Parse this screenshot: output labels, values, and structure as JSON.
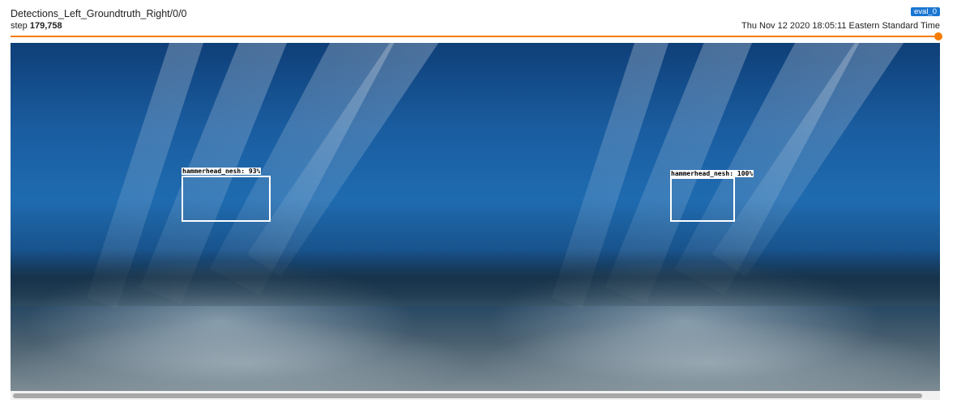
{
  "card": {
    "title": "Detections_Left_Groundtruth_Right/0/0",
    "step_label": "step",
    "step_value": "179,758",
    "run_badge": "eval_0",
    "timestamp": "Thu Nov 12 2020 18:05:11 Eastern Standard Time"
  },
  "slider": {
    "accent_color": "#f57c00",
    "position_fraction": 1.0
  },
  "image": {
    "left_panel": {
      "detection_label": "hammerhead_nesh: 93%"
    },
    "right_panel": {
      "detection_label": "hammerhead_nesh: 100%"
    }
  },
  "run_badge_color": "#1976d2"
}
